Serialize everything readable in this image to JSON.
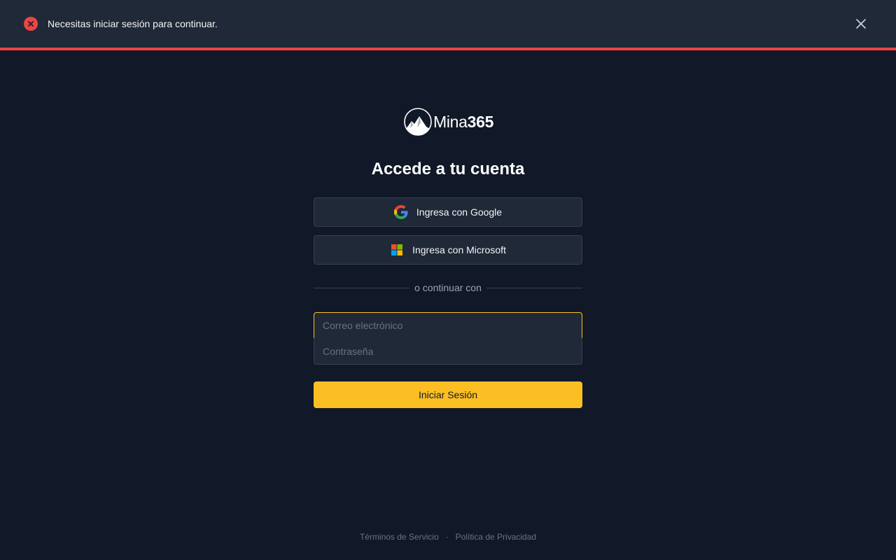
{
  "alert": {
    "message": "Necesitas iniciar sesión para continuar.",
    "accent_color": "#ef4444"
  },
  "brand": {
    "name_light": "Mina",
    "name_bold": "365"
  },
  "login": {
    "heading": "Accede a tu cuenta",
    "google_label": "Ingresa con Google",
    "microsoft_label": "Ingresa con Microsoft",
    "divider_text": "o continuar con",
    "email_placeholder": "Correo electrónico",
    "password_placeholder": "Contraseña",
    "submit_label": "Iniciar Sesión",
    "accent_color": "#fbbf24"
  },
  "footer": {
    "terms_label": "Términos de Servicio",
    "separator": "·",
    "privacy_label": "Política de Privacidad"
  }
}
